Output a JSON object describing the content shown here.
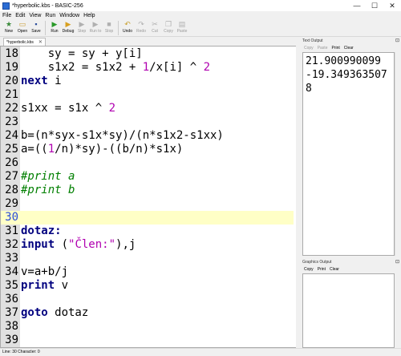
{
  "window": {
    "title": "*hyperbolic.kbs - BASIC-256",
    "minimize": "—",
    "maximize": "☐",
    "close": "✕"
  },
  "menu": [
    "File",
    "Edit",
    "View",
    "Run",
    "Window",
    "Help"
  ],
  "toolbar": [
    {
      "label": "New",
      "icon": "★",
      "color": "#3a8a3a",
      "disabled": false
    },
    {
      "label": "Open",
      "icon": "▭",
      "color": "#c99a2e",
      "disabled": false
    },
    {
      "label": "Save",
      "icon": "▪",
      "color": "#2a4c9a",
      "disabled": false
    },
    {
      "label": "Run",
      "icon": "▶",
      "color": "#2a9a2a",
      "disabled": false
    },
    {
      "label": "Debug",
      "icon": "▶",
      "color": "#d8a020",
      "disabled": false
    },
    {
      "label": "Step",
      "icon": "▶",
      "color": "#b0b0b0",
      "disabled": true
    },
    {
      "label": "Run to",
      "icon": "▶",
      "color": "#b0b0b0",
      "disabled": true
    },
    {
      "label": "Stop",
      "icon": "■",
      "color": "#b0b0b0",
      "disabled": true
    },
    {
      "label": "Undo",
      "icon": "↶",
      "color": "#c8a030",
      "disabled": false
    },
    {
      "label": "Redo",
      "icon": "↷",
      "color": "#b0b0b0",
      "disabled": true
    },
    {
      "label": "Cut",
      "icon": "✂",
      "color": "#b0b0b0",
      "disabled": true
    },
    {
      "label": "Copy",
      "icon": "❐",
      "color": "#b0b0b0",
      "disabled": true
    },
    {
      "label": "Paste",
      "icon": "▤",
      "color": "#b0b0b0",
      "disabled": true
    }
  ],
  "tab": {
    "label": "*hyperbolic.kbs",
    "close": "✕"
  },
  "editor": {
    "current_line": 30,
    "lines": [
      {
        "n": "18",
        "tokens": [
          [
            "    sy = sy + y[i]",
            ""
          ]
        ]
      },
      {
        "n": "19",
        "tokens": [
          [
            "    s1x2 = s1x2 + ",
            ""
          ],
          [
            "1",
            "nm"
          ],
          [
            "/x[i] ^ ",
            ""
          ],
          [
            "2",
            "nm"
          ]
        ]
      },
      {
        "n": "20",
        "tokens": [
          [
            "next",
            "kw"
          ],
          [
            " i",
            ""
          ]
        ]
      },
      {
        "n": "21",
        "tokens": []
      },
      {
        "n": "22",
        "tokens": [
          [
            "s1xx = s1x ^ ",
            ""
          ],
          [
            "2",
            "nm"
          ]
        ]
      },
      {
        "n": "23",
        "tokens": []
      },
      {
        "n": "24",
        "tokens": [
          [
            "b=(n*syx-s1x*sy)/(n*s1x2-s1xx)",
            ""
          ]
        ]
      },
      {
        "n": "25",
        "tokens": [
          [
            "a=((",
            ""
          ],
          [
            "1",
            "nm"
          ],
          [
            "/n)*sy)-((b/n)*s1x)",
            ""
          ]
        ]
      },
      {
        "n": "26",
        "tokens": []
      },
      {
        "n": "27",
        "tokens": [
          [
            "#print a",
            "cm"
          ]
        ]
      },
      {
        "n": "28",
        "tokens": [
          [
            "#print b",
            "cm"
          ]
        ]
      },
      {
        "n": "29",
        "tokens": []
      },
      {
        "n": "30",
        "tokens": []
      },
      {
        "n": "31",
        "tokens": [
          [
            "dotaz:",
            "fn"
          ]
        ]
      },
      {
        "n": "32",
        "tokens": [
          [
            "input",
            "kw"
          ],
          [
            " (",
            ""
          ],
          [
            "\"Člen:\"",
            "st"
          ],
          [
            "),j",
            ""
          ]
        ]
      },
      {
        "n": "33",
        "tokens": []
      },
      {
        "n": "34",
        "tokens": [
          [
            "v=a+b/j",
            ""
          ]
        ]
      },
      {
        "n": "35",
        "tokens": [
          [
            "print",
            "kw"
          ],
          [
            " v",
            ""
          ]
        ]
      },
      {
        "n": "36",
        "tokens": []
      },
      {
        "n": "37",
        "tokens": [
          [
            "goto",
            "kw"
          ],
          [
            " dotaz",
            ""
          ]
        ]
      },
      {
        "n": "38",
        "tokens": []
      },
      {
        "n": "39",
        "tokens": []
      }
    ]
  },
  "text_output": {
    "title": "Text Output",
    "buttons": [
      "Copy",
      "Paste",
      "Print",
      "Clear"
    ],
    "disabled": [
      true,
      true,
      false,
      false
    ],
    "lines": [
      "21.900990099",
      "-19.349363507",
      "8"
    ]
  },
  "graphics_output": {
    "title": "Graphics Output",
    "buttons": [
      "Copy",
      "Print",
      "Clear"
    ]
  },
  "status": "Line: 30 Character: 0"
}
